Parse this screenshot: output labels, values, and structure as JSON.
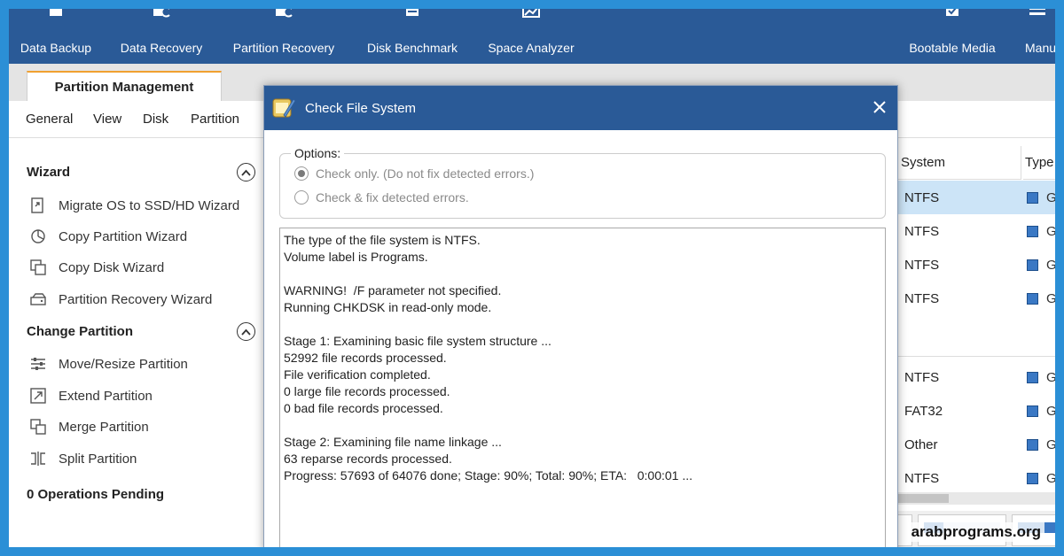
{
  "toolbar": {
    "items": [
      {
        "label": "Data Backup",
        "icon": "backup-icon"
      },
      {
        "label": "Data Recovery",
        "icon": "data-recovery-icon"
      },
      {
        "label": "Partition Recovery",
        "icon": "partition-recovery-icon"
      },
      {
        "label": "Disk Benchmark",
        "icon": "benchmark-icon"
      },
      {
        "label": "Space Analyzer",
        "icon": "space-analyzer-icon"
      },
      {
        "label": "Bootable Media",
        "icon": "bootable-media-icon"
      },
      {
        "label": "Manu",
        "icon": "manual-icon"
      }
    ]
  },
  "tabs": {
    "active": "Partition Management"
  },
  "menu": {
    "general": "General",
    "view": "View",
    "disk": "Disk",
    "partition": "Partition"
  },
  "sidebar": {
    "wizard_heading": "Wizard",
    "wizard_items": [
      "Migrate OS to SSD/HD Wizard",
      "Copy Partition Wizard",
      "Copy Disk Wizard",
      "Partition Recovery Wizard"
    ],
    "change_heading": "Change Partition",
    "change_items": [
      "Move/Resize Partition",
      "Extend Partition",
      "Merge Partition",
      "Split Partition"
    ],
    "pending": "0 Operations Pending"
  },
  "table": {
    "col_system": "System",
    "col_type": "Type",
    "rows": [
      "NTFS",
      "NTFS",
      "NTFS",
      "NTFS",
      "NTFS",
      "FAT32",
      "Other",
      "NTFS"
    ],
    "type_label": "G"
  },
  "dialog": {
    "title": "Check File System",
    "options_label": "Options:",
    "option_check_only": "Check only. (Do not fix detected errors.)",
    "option_check_fix": "Check & fix detected errors.",
    "selected_option": "check_only",
    "log": [
      "The type of the file system is NTFS.",
      "Volume label is Programs.",
      "",
      "WARNING!  /F parameter not specified.",
      "Running CHKDSK in read-only mode.",
      "",
      "Stage 1: Examining basic file system structure ...",
      "52992 file records processed.",
      "File verification completed.",
      "0 large file records processed.",
      "0 bad file records processed.",
      "",
      "Stage 2: Examining file name linkage ...",
      "63 reparse records processed.",
      "Progress: 57693 of 64076 done; Stage: 90%; Total: 90%; ETA:   0:00:01 ..."
    ]
  },
  "watermark": "arabprograms.org",
  "colors": {
    "titlebar": "#2a5a97",
    "border_frame": "#2b8fd6",
    "accent_tab": "#f0a030",
    "type_square": "#3a78c4"
  }
}
